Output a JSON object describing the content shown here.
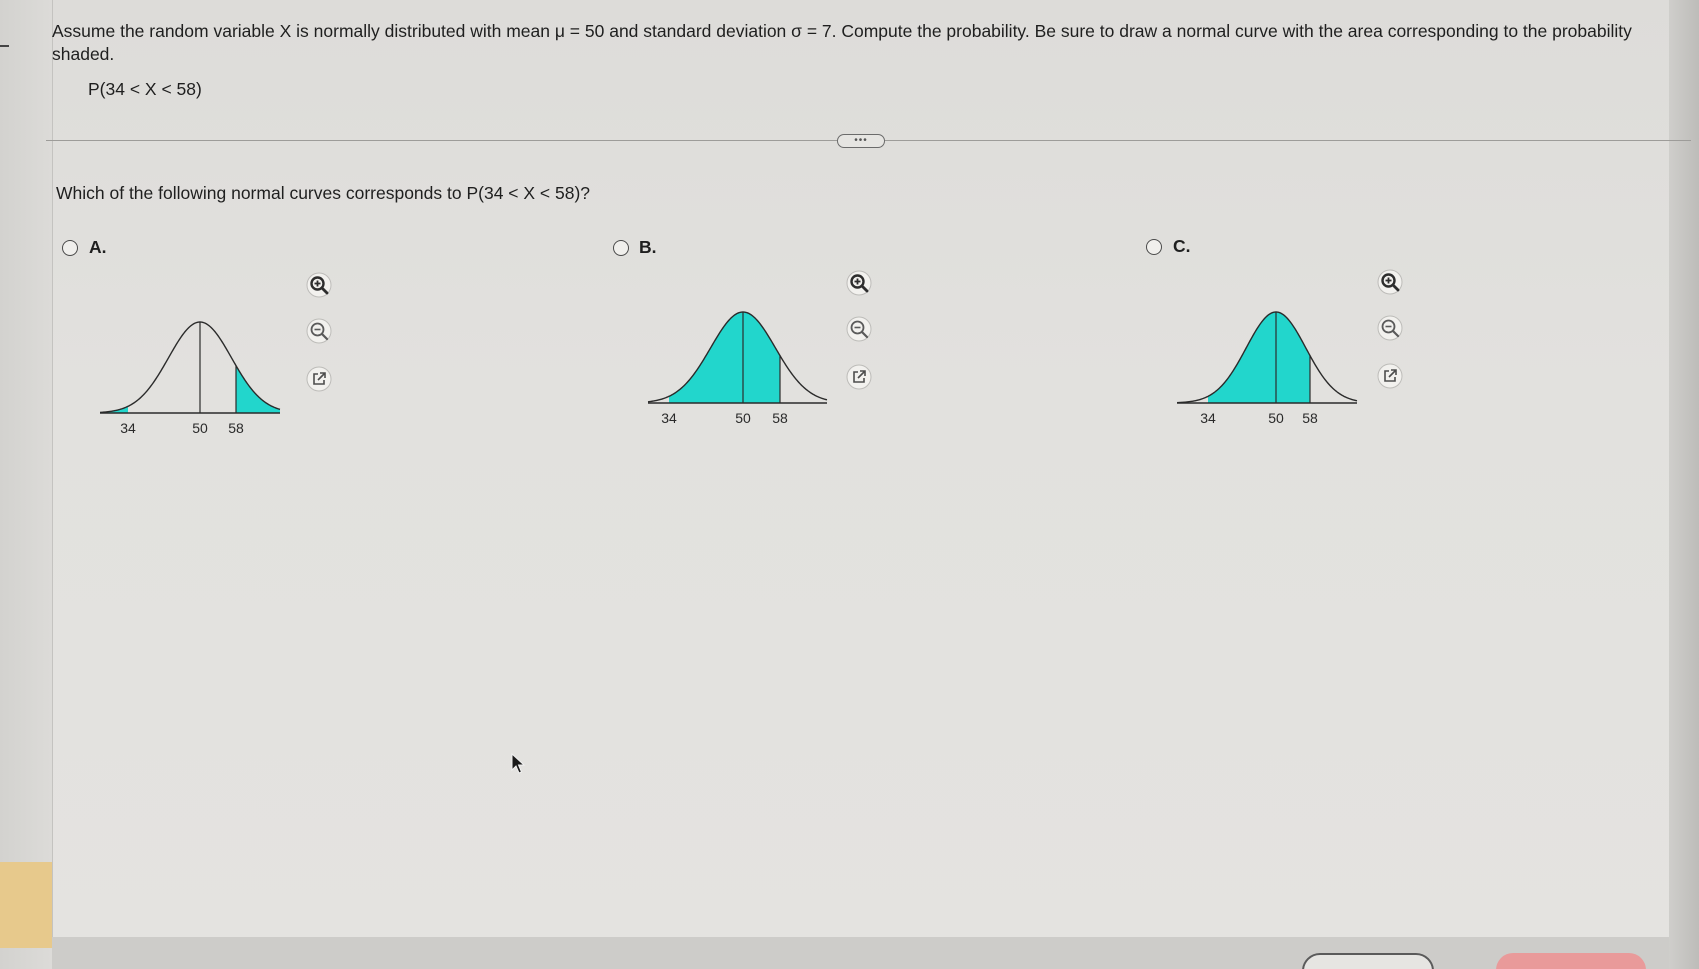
{
  "question": {
    "text": "Assume the random variable X is normally distributed with mean μ = 50 and standard deviation σ = 7. Compute the probability. Be sure to draw a normal curve with the area corresponding to the probability shaded.",
    "probability": "P(34 < X < 58)",
    "more_label": "•••"
  },
  "prompt": "Which of the following normal curves corresponds to P(34 < X < 58)?",
  "options": [
    {
      "label": "A.",
      "ticks": [
        "34",
        "50",
        "58"
      ],
      "shading": "both tails"
    },
    {
      "label": "B.",
      "ticks": [
        "34",
        "50",
        "58"
      ],
      "shading": "between"
    },
    {
      "label": "C.",
      "ticks": [
        "34",
        "50",
        "58"
      ],
      "shading": "between"
    }
  ],
  "tools": [
    "zoom-in-icon",
    "zoom-out-icon",
    "open-in-new-window-icon"
  ],
  "colors": {
    "shade": "#22d6cc",
    "curve": "#2b2b2b",
    "background": "#e3e2df"
  }
}
